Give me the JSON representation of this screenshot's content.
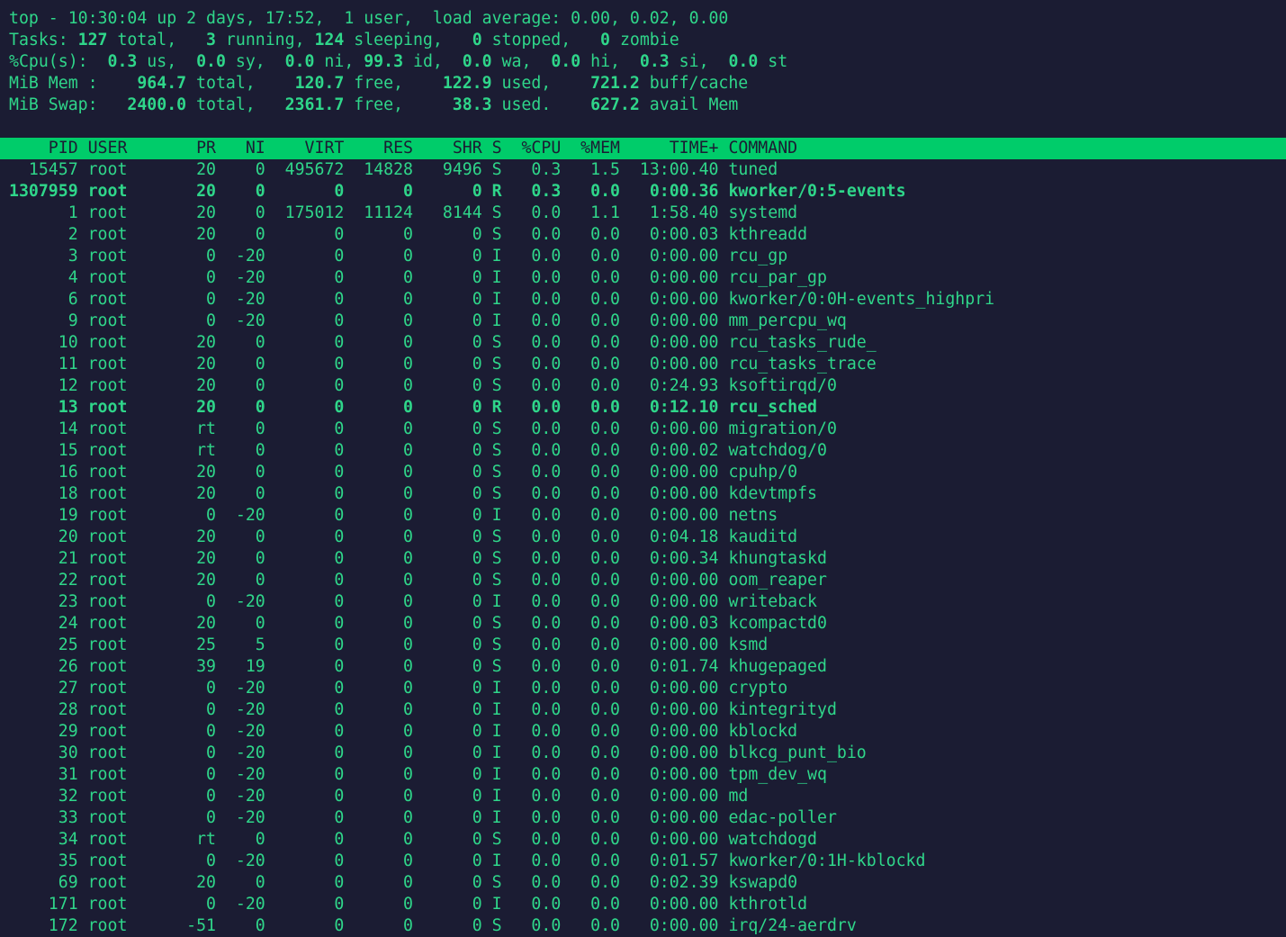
{
  "summary": {
    "top": {
      "prefix": "top - ",
      "time": "10:30:04",
      "uptime_label": " up 2 days, 17:52,  ",
      "users": "1",
      "users_label": " user,  load average: ",
      "load": "0.00, 0.02, 0.00"
    },
    "tasks": {
      "label": "Tasks: ",
      "total": "127",
      "total_label": " total,   ",
      "running": "3",
      "running_label": " running, ",
      "sleeping": "124",
      "sleeping_label": " sleeping,   ",
      "stopped": "0",
      "stopped_label": " stopped,   ",
      "zombie": "0",
      "zombie_label": " zombie"
    },
    "cpu": {
      "label": "%Cpu(s):  ",
      "us": "0.3",
      "us_label": " us,  ",
      "sy": "0.0",
      "sy_label": " sy,  ",
      "ni": "0.0",
      "ni_label": " ni, ",
      "id": "99.3",
      "id_label": " id,  ",
      "wa": "0.0",
      "wa_label": " wa,  ",
      "hi": "0.0",
      "hi_label": " hi,  ",
      "si": "0.3",
      "si_label": " si,  ",
      "st": "0.0",
      "st_label": " st"
    },
    "mem": {
      "label": "MiB Mem :    ",
      "total": "964.7",
      "total_label": " total,    ",
      "free": "120.7",
      "free_label": " free,    ",
      "used": "122.9",
      "used_label": " used,    ",
      "cache": "721.2",
      "cache_label": " buff/cache"
    },
    "swap": {
      "label": "MiB Swap:   ",
      "total": "2400.0",
      "total_label": " total,   ",
      "free": "2361.7",
      "free_label": " free,     ",
      "used": "38.3",
      "used_label": " used.    ",
      "avail": "627.2",
      "avail_label": " avail Mem"
    }
  },
  "columns": [
    "PID",
    "USER",
    "PR",
    "NI",
    "VIRT",
    "RES",
    "SHR",
    "S",
    "%CPU",
    "%MEM",
    "TIME+",
    "COMMAND"
  ],
  "processes": [
    {
      "pid": "15457",
      "user": "root",
      "pr": "20",
      "ni": "0",
      "virt": "495672",
      "res": "14828",
      "shr": "9496",
      "s": "S",
      "cpu": "0.3",
      "mem": "1.5",
      "time": "13:00.40",
      "command": "tuned",
      "bold": false
    },
    {
      "pid": "1307959",
      "user": "root",
      "pr": "20",
      "ni": "0",
      "virt": "0",
      "res": "0",
      "shr": "0",
      "s": "R",
      "cpu": "0.3",
      "mem": "0.0",
      "time": "0:00.36",
      "command": "kworker/0:5-events",
      "bold": true
    },
    {
      "pid": "1",
      "user": "root",
      "pr": "20",
      "ni": "0",
      "virt": "175012",
      "res": "11124",
      "shr": "8144",
      "s": "S",
      "cpu": "0.0",
      "mem": "1.1",
      "time": "1:58.40",
      "command": "systemd",
      "bold": false
    },
    {
      "pid": "2",
      "user": "root",
      "pr": "20",
      "ni": "0",
      "virt": "0",
      "res": "0",
      "shr": "0",
      "s": "S",
      "cpu": "0.0",
      "mem": "0.0",
      "time": "0:00.03",
      "command": "kthreadd",
      "bold": false
    },
    {
      "pid": "3",
      "user": "root",
      "pr": "0",
      "ni": "-20",
      "virt": "0",
      "res": "0",
      "shr": "0",
      "s": "I",
      "cpu": "0.0",
      "mem": "0.0",
      "time": "0:00.00",
      "command": "rcu_gp",
      "bold": false
    },
    {
      "pid": "4",
      "user": "root",
      "pr": "0",
      "ni": "-20",
      "virt": "0",
      "res": "0",
      "shr": "0",
      "s": "I",
      "cpu": "0.0",
      "mem": "0.0",
      "time": "0:00.00",
      "command": "rcu_par_gp",
      "bold": false
    },
    {
      "pid": "6",
      "user": "root",
      "pr": "0",
      "ni": "-20",
      "virt": "0",
      "res": "0",
      "shr": "0",
      "s": "I",
      "cpu": "0.0",
      "mem": "0.0",
      "time": "0:00.00",
      "command": "kworker/0:0H-events_highpri",
      "bold": false
    },
    {
      "pid": "9",
      "user": "root",
      "pr": "0",
      "ni": "-20",
      "virt": "0",
      "res": "0",
      "shr": "0",
      "s": "I",
      "cpu": "0.0",
      "mem": "0.0",
      "time": "0:00.00",
      "command": "mm_percpu_wq",
      "bold": false
    },
    {
      "pid": "10",
      "user": "root",
      "pr": "20",
      "ni": "0",
      "virt": "0",
      "res": "0",
      "shr": "0",
      "s": "S",
      "cpu": "0.0",
      "mem": "0.0",
      "time": "0:00.00",
      "command": "rcu_tasks_rude_",
      "bold": false
    },
    {
      "pid": "11",
      "user": "root",
      "pr": "20",
      "ni": "0",
      "virt": "0",
      "res": "0",
      "shr": "0",
      "s": "S",
      "cpu": "0.0",
      "mem": "0.0",
      "time": "0:00.00",
      "command": "rcu_tasks_trace",
      "bold": false
    },
    {
      "pid": "12",
      "user": "root",
      "pr": "20",
      "ni": "0",
      "virt": "0",
      "res": "0",
      "shr": "0",
      "s": "S",
      "cpu": "0.0",
      "mem": "0.0",
      "time": "0:24.93",
      "command": "ksoftirqd/0",
      "bold": false
    },
    {
      "pid": "13",
      "user": "root",
      "pr": "20",
      "ni": "0",
      "virt": "0",
      "res": "0",
      "shr": "0",
      "s": "R",
      "cpu": "0.0",
      "mem": "0.0",
      "time": "0:12.10",
      "command": "rcu_sched",
      "bold": true
    },
    {
      "pid": "14",
      "user": "root",
      "pr": "rt",
      "ni": "0",
      "virt": "0",
      "res": "0",
      "shr": "0",
      "s": "S",
      "cpu": "0.0",
      "mem": "0.0",
      "time": "0:00.00",
      "command": "migration/0",
      "bold": false
    },
    {
      "pid": "15",
      "user": "root",
      "pr": "rt",
      "ni": "0",
      "virt": "0",
      "res": "0",
      "shr": "0",
      "s": "S",
      "cpu": "0.0",
      "mem": "0.0",
      "time": "0:00.02",
      "command": "watchdog/0",
      "bold": false
    },
    {
      "pid": "16",
      "user": "root",
      "pr": "20",
      "ni": "0",
      "virt": "0",
      "res": "0",
      "shr": "0",
      "s": "S",
      "cpu": "0.0",
      "mem": "0.0",
      "time": "0:00.00",
      "command": "cpuhp/0",
      "bold": false
    },
    {
      "pid": "18",
      "user": "root",
      "pr": "20",
      "ni": "0",
      "virt": "0",
      "res": "0",
      "shr": "0",
      "s": "S",
      "cpu": "0.0",
      "mem": "0.0",
      "time": "0:00.00",
      "command": "kdevtmpfs",
      "bold": false
    },
    {
      "pid": "19",
      "user": "root",
      "pr": "0",
      "ni": "-20",
      "virt": "0",
      "res": "0",
      "shr": "0",
      "s": "I",
      "cpu": "0.0",
      "mem": "0.0",
      "time": "0:00.00",
      "command": "netns",
      "bold": false
    },
    {
      "pid": "20",
      "user": "root",
      "pr": "20",
      "ni": "0",
      "virt": "0",
      "res": "0",
      "shr": "0",
      "s": "S",
      "cpu": "0.0",
      "mem": "0.0",
      "time": "0:04.18",
      "command": "kauditd",
      "bold": false
    },
    {
      "pid": "21",
      "user": "root",
      "pr": "20",
      "ni": "0",
      "virt": "0",
      "res": "0",
      "shr": "0",
      "s": "S",
      "cpu": "0.0",
      "mem": "0.0",
      "time": "0:00.34",
      "command": "khungtaskd",
      "bold": false
    },
    {
      "pid": "22",
      "user": "root",
      "pr": "20",
      "ni": "0",
      "virt": "0",
      "res": "0",
      "shr": "0",
      "s": "S",
      "cpu": "0.0",
      "mem": "0.0",
      "time": "0:00.00",
      "command": "oom_reaper",
      "bold": false
    },
    {
      "pid": "23",
      "user": "root",
      "pr": "0",
      "ni": "-20",
      "virt": "0",
      "res": "0",
      "shr": "0",
      "s": "I",
      "cpu": "0.0",
      "mem": "0.0",
      "time": "0:00.00",
      "command": "writeback",
      "bold": false
    },
    {
      "pid": "24",
      "user": "root",
      "pr": "20",
      "ni": "0",
      "virt": "0",
      "res": "0",
      "shr": "0",
      "s": "S",
      "cpu": "0.0",
      "mem": "0.0",
      "time": "0:00.03",
      "command": "kcompactd0",
      "bold": false
    },
    {
      "pid": "25",
      "user": "root",
      "pr": "25",
      "ni": "5",
      "virt": "0",
      "res": "0",
      "shr": "0",
      "s": "S",
      "cpu": "0.0",
      "mem": "0.0",
      "time": "0:00.00",
      "command": "ksmd",
      "bold": false
    },
    {
      "pid": "26",
      "user": "root",
      "pr": "39",
      "ni": "19",
      "virt": "0",
      "res": "0",
      "shr": "0",
      "s": "S",
      "cpu": "0.0",
      "mem": "0.0",
      "time": "0:01.74",
      "command": "khugepaged",
      "bold": false
    },
    {
      "pid": "27",
      "user": "root",
      "pr": "0",
      "ni": "-20",
      "virt": "0",
      "res": "0",
      "shr": "0",
      "s": "I",
      "cpu": "0.0",
      "mem": "0.0",
      "time": "0:00.00",
      "command": "crypto",
      "bold": false
    },
    {
      "pid": "28",
      "user": "root",
      "pr": "0",
      "ni": "-20",
      "virt": "0",
      "res": "0",
      "shr": "0",
      "s": "I",
      "cpu": "0.0",
      "mem": "0.0",
      "time": "0:00.00",
      "command": "kintegrityd",
      "bold": false
    },
    {
      "pid": "29",
      "user": "root",
      "pr": "0",
      "ni": "-20",
      "virt": "0",
      "res": "0",
      "shr": "0",
      "s": "I",
      "cpu": "0.0",
      "mem": "0.0",
      "time": "0:00.00",
      "command": "kblockd",
      "bold": false
    },
    {
      "pid": "30",
      "user": "root",
      "pr": "0",
      "ni": "-20",
      "virt": "0",
      "res": "0",
      "shr": "0",
      "s": "I",
      "cpu": "0.0",
      "mem": "0.0",
      "time": "0:00.00",
      "command": "blkcg_punt_bio",
      "bold": false
    },
    {
      "pid": "31",
      "user": "root",
      "pr": "0",
      "ni": "-20",
      "virt": "0",
      "res": "0",
      "shr": "0",
      "s": "I",
      "cpu": "0.0",
      "mem": "0.0",
      "time": "0:00.00",
      "command": "tpm_dev_wq",
      "bold": false
    },
    {
      "pid": "32",
      "user": "root",
      "pr": "0",
      "ni": "-20",
      "virt": "0",
      "res": "0",
      "shr": "0",
      "s": "I",
      "cpu": "0.0",
      "mem": "0.0",
      "time": "0:00.00",
      "command": "md",
      "bold": false
    },
    {
      "pid": "33",
      "user": "root",
      "pr": "0",
      "ni": "-20",
      "virt": "0",
      "res": "0",
      "shr": "0",
      "s": "I",
      "cpu": "0.0",
      "mem": "0.0",
      "time": "0:00.00",
      "command": "edac-poller",
      "bold": false
    },
    {
      "pid": "34",
      "user": "root",
      "pr": "rt",
      "ni": "0",
      "virt": "0",
      "res": "0",
      "shr": "0",
      "s": "S",
      "cpu": "0.0",
      "mem": "0.0",
      "time": "0:00.00",
      "command": "watchdogd",
      "bold": false
    },
    {
      "pid": "35",
      "user": "root",
      "pr": "0",
      "ni": "-20",
      "virt": "0",
      "res": "0",
      "shr": "0",
      "s": "I",
      "cpu": "0.0",
      "mem": "0.0",
      "time": "0:01.57",
      "command": "kworker/0:1H-kblockd",
      "bold": false
    },
    {
      "pid": "69",
      "user": "root",
      "pr": "20",
      "ni": "0",
      "virt": "0",
      "res": "0",
      "shr": "0",
      "s": "S",
      "cpu": "0.0",
      "mem": "0.0",
      "time": "0:02.39",
      "command": "kswapd0",
      "bold": false
    },
    {
      "pid": "171",
      "user": "root",
      "pr": "0",
      "ni": "-20",
      "virt": "0",
      "res": "0",
      "shr": "0",
      "s": "I",
      "cpu": "0.0",
      "mem": "0.0",
      "time": "0:00.00",
      "command": "kthrotld",
      "bold": false
    },
    {
      "pid": "172",
      "user": "root",
      "pr": "-51",
      "ni": "0",
      "virt": "0",
      "res": "0",
      "shr": "0",
      "s": "S",
      "cpu": "0.0",
      "mem": "0.0",
      "time": "0:00.00",
      "command": "irq/24-aerdrv",
      "bold": false
    }
  ],
  "colors": {
    "background": "#1b1c33",
    "foreground": "#2fd68a",
    "header_bg": "#00cc6a",
    "header_fg": "#1b1c33"
  }
}
